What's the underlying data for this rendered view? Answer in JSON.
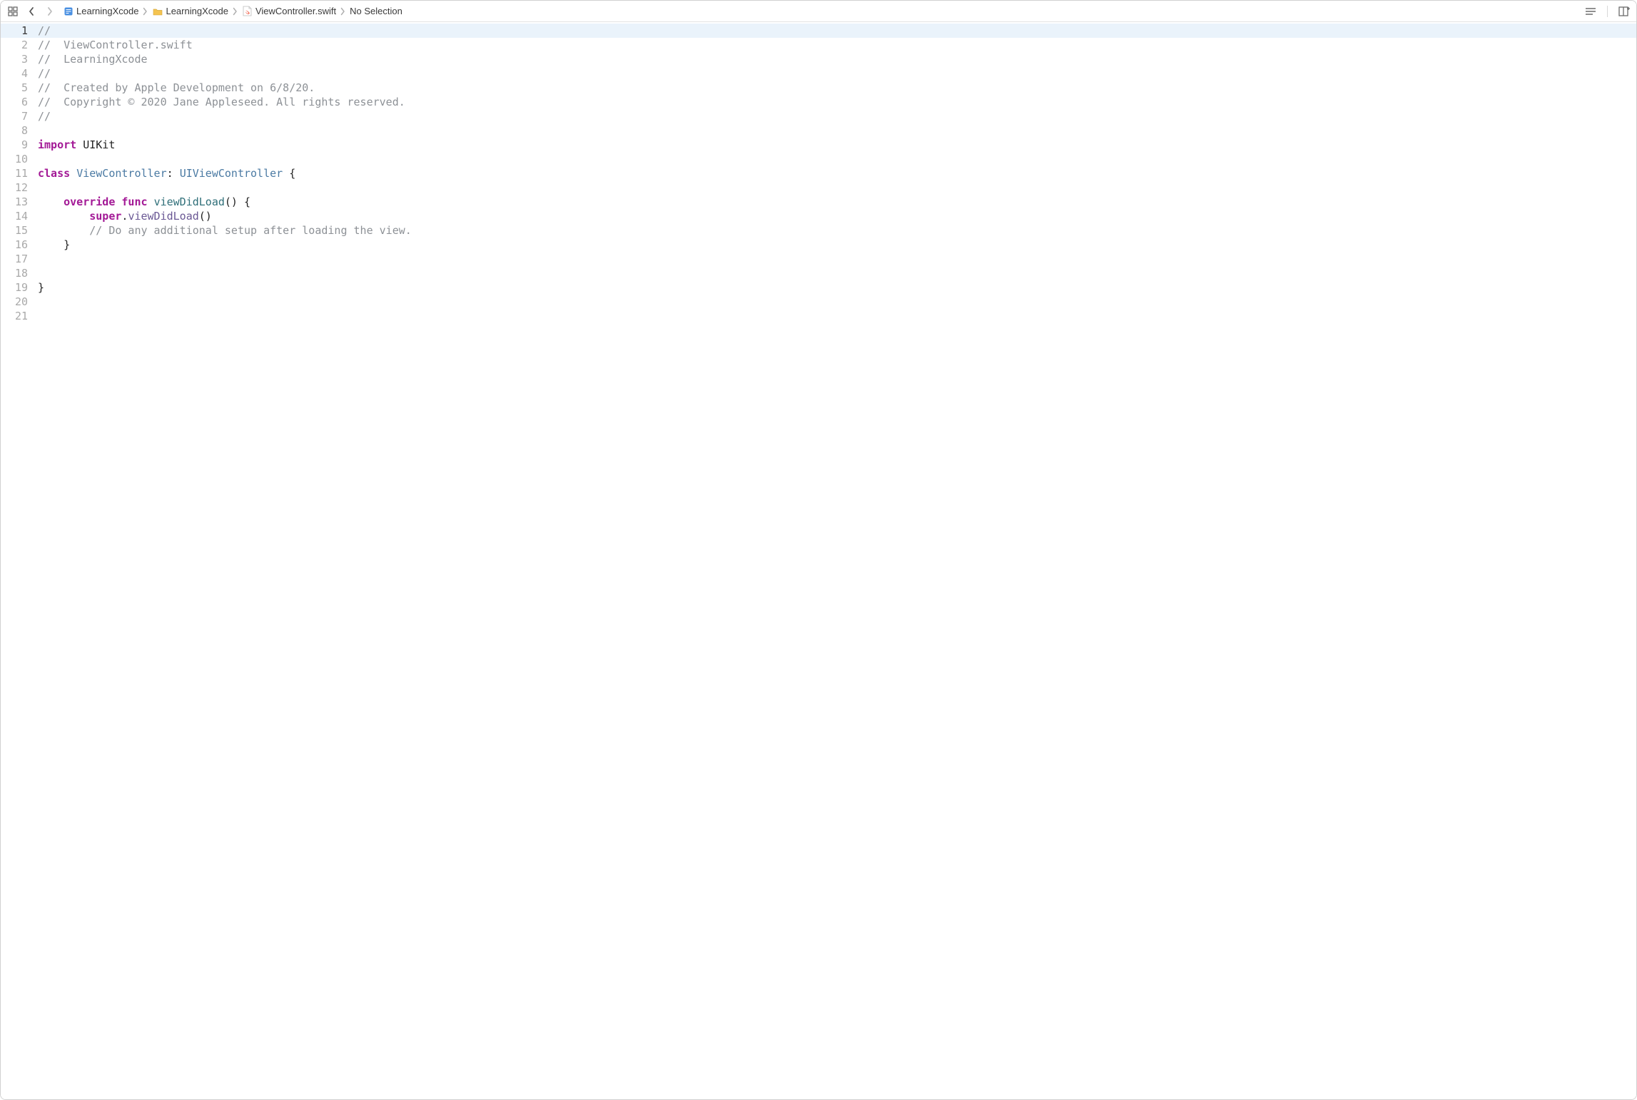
{
  "breadcrumbs": {
    "project": "LearningXcode",
    "group": "LearningXcode",
    "file": "ViewController.swift",
    "selection": "No Selection"
  },
  "icons": {
    "related_items": "related-items-icon",
    "nav_back": "chevron-left-icon",
    "nav_forward": "chevron-right-icon",
    "adjust_editor": "lines-icon",
    "split_editor": "add-editor-icon",
    "project_file": "xcodeproj-icon",
    "folder": "folder-icon",
    "swift_file": "swift-file-icon"
  },
  "editor": {
    "current_line": 1,
    "lines": [
      {
        "n": 1,
        "tokens": [
          {
            "c": "tok-comment",
            "t": "//"
          }
        ]
      },
      {
        "n": 2,
        "tokens": [
          {
            "c": "tok-comment",
            "t": "//  ViewController.swift"
          }
        ]
      },
      {
        "n": 3,
        "tokens": [
          {
            "c": "tok-comment",
            "t": "//  LearningXcode"
          }
        ]
      },
      {
        "n": 4,
        "tokens": [
          {
            "c": "tok-comment",
            "t": "//"
          }
        ]
      },
      {
        "n": 5,
        "tokens": [
          {
            "c": "tok-comment",
            "t": "//  Created by Apple Development on 6/8/20."
          }
        ]
      },
      {
        "n": 6,
        "tokens": [
          {
            "c": "tok-comment",
            "t": "//  Copyright © 2020 Jane Appleseed. All rights reserved."
          }
        ]
      },
      {
        "n": 7,
        "tokens": [
          {
            "c": "tok-comment",
            "t": "//"
          }
        ]
      },
      {
        "n": 8,
        "tokens": [
          {
            "c": "tok-plain",
            "t": ""
          }
        ]
      },
      {
        "n": 9,
        "tokens": [
          {
            "c": "tok-keyword",
            "t": "import"
          },
          {
            "c": "tok-plain",
            "t": " "
          },
          {
            "c": "tok-uikit",
            "t": "UIKit"
          }
        ]
      },
      {
        "n": 10,
        "tokens": [
          {
            "c": "tok-plain",
            "t": ""
          }
        ]
      },
      {
        "n": 11,
        "tokens": [
          {
            "c": "tok-classkw",
            "t": "class"
          },
          {
            "c": "tok-plain",
            "t": " "
          },
          {
            "c": "tok-type",
            "t": "ViewController"
          },
          {
            "c": "tok-plain",
            "t": ": "
          },
          {
            "c": "tok-type",
            "t": "UIViewController"
          },
          {
            "c": "tok-plain",
            "t": " {"
          }
        ]
      },
      {
        "n": 12,
        "tokens": [
          {
            "c": "tok-plain",
            "t": ""
          }
        ]
      },
      {
        "n": 13,
        "tokens": [
          {
            "c": "tok-plain",
            "t": "    "
          },
          {
            "c": "tok-keyword",
            "t": "override"
          },
          {
            "c": "tok-plain",
            "t": " "
          },
          {
            "c": "tok-keyword",
            "t": "func"
          },
          {
            "c": "tok-plain",
            "t": " "
          },
          {
            "c": "tok-fname",
            "t": "viewDidLoad"
          },
          {
            "c": "tok-plain",
            "t": "() {"
          }
        ]
      },
      {
        "n": 14,
        "tokens": [
          {
            "c": "tok-plain",
            "t": "        "
          },
          {
            "c": "tok-super",
            "t": "super"
          },
          {
            "c": "tok-plain",
            "t": "."
          },
          {
            "c": "tok-method",
            "t": "viewDidLoad"
          },
          {
            "c": "tok-plain",
            "t": "()"
          }
        ]
      },
      {
        "n": 15,
        "tokens": [
          {
            "c": "tok-plain",
            "t": "        "
          },
          {
            "c": "tok-comment",
            "t": "// Do any additional setup after loading the view."
          }
        ]
      },
      {
        "n": 16,
        "tokens": [
          {
            "c": "tok-plain",
            "t": "    }"
          }
        ]
      },
      {
        "n": 17,
        "tokens": [
          {
            "c": "tok-plain",
            "t": ""
          }
        ]
      },
      {
        "n": 18,
        "tokens": [
          {
            "c": "tok-plain",
            "t": ""
          }
        ]
      },
      {
        "n": 19,
        "tokens": [
          {
            "c": "tok-plain",
            "t": "}"
          }
        ]
      },
      {
        "n": 20,
        "tokens": [
          {
            "c": "tok-plain",
            "t": ""
          }
        ]
      },
      {
        "n": 21,
        "tokens": [
          {
            "c": "tok-plain",
            "t": ""
          }
        ]
      }
    ]
  }
}
